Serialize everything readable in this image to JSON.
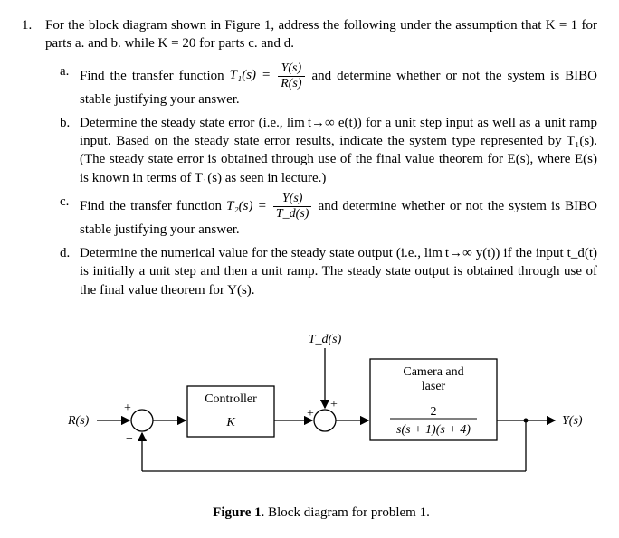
{
  "problem": {
    "number": "1.",
    "intro": "For the block diagram shown in Figure 1, address the following under the assumption that K = 1 for parts a. and b. while K = 20 for parts c. and d.",
    "parts": {
      "a": {
        "label": "a.",
        "pre": "Find the transfer function ",
        "t1": "T₁(s) = ",
        "frac_num": "Y(s)",
        "frac_den": "R(s)",
        "post": " and determine whether or not the system is BIBO stable justifying your answer."
      },
      "b": {
        "label": "b.",
        "text": "Determine the steady state error (i.e., lim t→∞ e(t)) for a unit step input as well as a unit ramp input. Based on the steady state error results, indicate the system type represented by T₁(s). (The steady state error is obtained through use of the final value theorem for E(s), where E(s) is known in terms of T₁(s) as seen in lecture.)"
      },
      "c": {
        "label": "c.",
        "pre": "Find the transfer function ",
        "t2": "T₂(s) = ",
        "frac_num": "Y(s)",
        "frac_den": "T_d(s)",
        "post": " and determine whether or not the system is BIBO stable justifying your answer."
      },
      "d": {
        "label": "d.",
        "text": "Determine the numerical value for the steady state output (i.e., lim t→∞ y(t)) if the input t_d(t) is initially a unit step and then a unit ramp. The steady state output is obtained through use of the final value theorem for Y(s)."
      }
    }
  },
  "diagram": {
    "input_label": "R(s)",
    "controller_box": "Controller",
    "controller_value": "K",
    "disturbance_label": "T_d(s)",
    "plant_box_top": "Camera and",
    "plant_box_bottom": "laser",
    "plant_num": "2",
    "plant_den": "s(s + 1)(s + 4)",
    "output_label": "Y(s)",
    "sum1_plus": "+",
    "sum1_minus": "−",
    "sum2_plus1": "+",
    "sum2_plus2": "+"
  },
  "caption": {
    "bold": "Figure 1",
    "rest": ". Block diagram for problem 1."
  }
}
